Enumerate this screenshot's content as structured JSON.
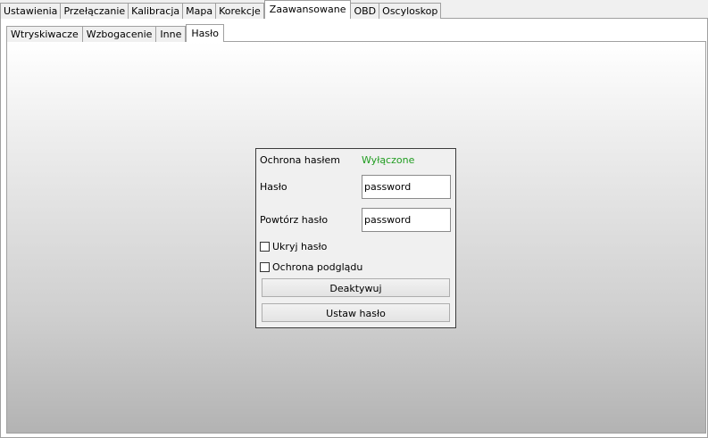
{
  "main_tabs": [
    "Ustawienia",
    "Przełączanie",
    "Kalibracja",
    "Mapa",
    "Korekcje",
    "Zaawansowane",
    "OBD",
    "Oscyloskop"
  ],
  "main_active": "Zaawansowane",
  "sub_tabs": [
    "Wtryskiwacze",
    "Wzbogacenie",
    "Inne",
    "Hasło"
  ],
  "sub_active": "Hasło",
  "panel": {
    "protection_label": "Ochrona hasłem",
    "protection_status": "Wyłączone",
    "status_color": "#1f9c1f",
    "password_label": "Hasło",
    "password_value": "password",
    "repeat_label": "Powtórz hasło",
    "repeat_value": "password",
    "hide_label": "Ukryj hasło",
    "hide_checked": false,
    "preview_label": "Ochrona podglądu",
    "preview_checked": false,
    "deactivate_label": "Deaktywuj",
    "set_label": "Ustaw hasło"
  }
}
